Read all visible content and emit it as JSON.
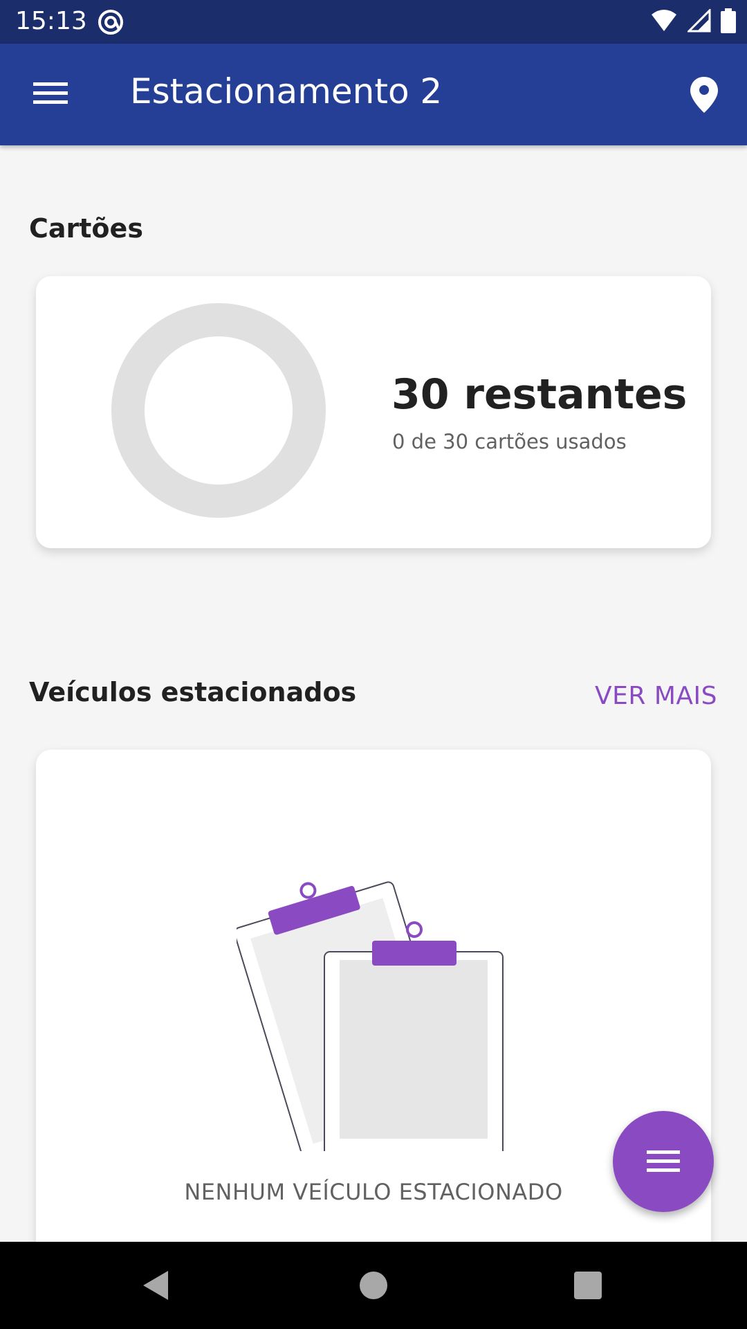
{
  "status_bar": {
    "time": "15:13",
    "icons": [
      "at-sign-icon",
      "wifi-icon",
      "signal-icon",
      "battery-icon"
    ]
  },
  "app_bar": {
    "title": "Estacionamento 2",
    "menu_icon": "hamburger-menu-icon",
    "action_icon": "location-pin-icon"
  },
  "cards_section": {
    "title": "Cartões",
    "remaining": "30 restantes",
    "usage": "0 de 30 cartões usados",
    "used_count": 0,
    "total_count": 30
  },
  "vehicles_section": {
    "title": "Veículos estacionados",
    "see_more": "VER MAIS",
    "empty_message": "NENHUM VEÍCULO ESTACIONADO",
    "empty_icon": "clipboards-icon"
  },
  "fab": {
    "icon": "menu-lines-icon"
  },
  "navigation": {
    "buttons": [
      "back-icon",
      "home-icon",
      "recents-icon"
    ]
  },
  "colors": {
    "status_bar": "#1c2d6b",
    "app_bar": "#243f95",
    "accent": "#8a4bc2",
    "background": "#f5f5f5",
    "donut_track": "#e0e0e0"
  }
}
